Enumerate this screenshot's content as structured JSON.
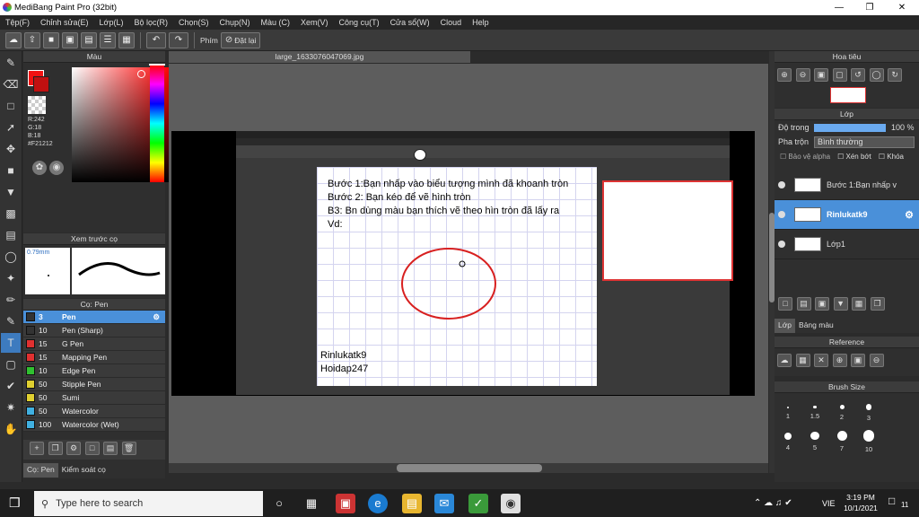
{
  "titlebar": {
    "title": "MediBang Paint Pro (32bit)"
  },
  "menu": [
    "Tệp(F)",
    "Chỉnh sửa(E)",
    "Lớp(L)",
    "Bộ lọc(R)",
    "Chọn(S)",
    "Chụp(N)",
    "Màu (C)",
    "Xem(V)",
    "Công cụ(T)",
    "Cửa sổ(W)",
    "Cloud",
    "Help"
  ],
  "toolbar": {
    "key_label": "Phím",
    "reset_label": "Đặt lại"
  },
  "color_panel": {
    "title": "Màu",
    "r": "R:242",
    "g": "G:18",
    "b": "B:18",
    "hex": "#F21212",
    "primary_color": "#F21212"
  },
  "preview_panel": {
    "title": "Xem trước cọ",
    "size": "0.79mm"
  },
  "brush_panel": {
    "title": "Cọ: Pen",
    "brushes": [
      {
        "size": "3",
        "name": "Pen",
        "color": "#333333",
        "active": true
      },
      {
        "size": "10",
        "name": "Pen (Sharp)",
        "color": "#333333"
      },
      {
        "size": "15",
        "name": "G Pen",
        "color": "#e03030"
      },
      {
        "size": "15",
        "name": "Mapping Pen",
        "color": "#e03030"
      },
      {
        "size": "10",
        "name": "Edge Pen",
        "color": "#30c030"
      },
      {
        "size": "50",
        "name": "Stipple Pen",
        "color": "#e0d030"
      },
      {
        "size": "50",
        "name": "Sumi",
        "color": "#e0d030"
      },
      {
        "size": "50",
        "name": "Watercolor",
        "color": "#40b0e0"
      },
      {
        "size": "100",
        "name": "Watercolor (Wet)",
        "color": "#40b0e0"
      }
    ],
    "tab_brush": "Cọ: Pen",
    "tab_control": "Kiểm soát cọ"
  },
  "document": {
    "tab_name": "large_1633076047069.jpg"
  },
  "image_text": {
    "line1": "Bước 1:Bạn nhấp vào biểu tượng mình đã khoanh tròn",
    "line2": "Bước 2: Bạn kéo để vẽ hình tròn",
    "line3": "B3: Bn dùng màu bạn thích vẽ theo hìn tròn đã lấy ra",
    "line4": "Vd:",
    "author1": "Rinlukatk9",
    "author2": "Hoidap247"
  },
  "navigator": {
    "title": "Hoa tiêu"
  },
  "layer_panel": {
    "title": "Lớp",
    "opacity_label": "Độ trong",
    "opacity_value": "100 %",
    "opacity_fraction": 1.0,
    "blend_label": "Pha trộn",
    "blend_value": "Bình thường",
    "protect_alpha": "Bảo vệ alpha",
    "clipping": "Xén bớt",
    "lock": "Khóa",
    "layers": [
      {
        "name": "Bước 1:Bạn nhấp v",
        "active": false
      },
      {
        "name": "Rinlukatk9",
        "active": true
      },
      {
        "name": "Lớp1",
        "active": false
      }
    ],
    "tab_layer": "Lớp",
    "tab_color": "Bảng màu"
  },
  "reference_panel": {
    "title": "Reference"
  },
  "brush_size_panel": {
    "title": "Brush Size",
    "sizes": [
      "1",
      "1.5",
      "2",
      "3",
      "4",
      "5",
      "7",
      "10"
    ]
  },
  "taskbar": {
    "search_placeholder": "Type here to search",
    "lang": "VIE",
    "time": "3:19 PM",
    "date": "10/1/2021",
    "notif": "11"
  }
}
